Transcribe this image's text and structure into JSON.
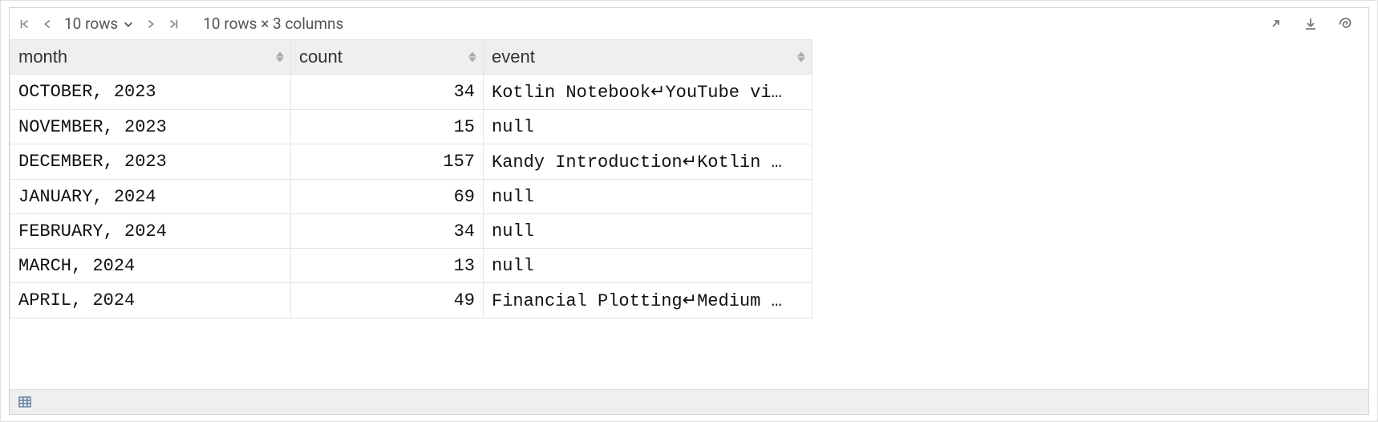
{
  "toolbar": {
    "rows_label": "10 rows",
    "summary": "10 rows × 3 columns"
  },
  "columns": {
    "month": "month",
    "count": "count",
    "event": "event"
  },
  "rows": [
    {
      "month": "OCTOBER, 2023",
      "count": "34",
      "event_pre": "Kotlin Notebook",
      "event_post": "YouTube vi…"
    },
    {
      "month": "NOVEMBER, 2023",
      "count": "15",
      "event_pre": "null",
      "event_post": ""
    },
    {
      "month": "DECEMBER, 2023",
      "count": "157",
      "event_pre": "Kandy Introduction",
      "event_post": "Kotlin …"
    },
    {
      "month": "JANUARY, 2024",
      "count": "69",
      "event_pre": "null",
      "event_post": ""
    },
    {
      "month": "FEBRUARY, 2024",
      "count": "34",
      "event_pre": "null",
      "event_post": ""
    },
    {
      "month": "MARCH, 2024",
      "count": "13",
      "event_pre": "null",
      "event_post": ""
    },
    {
      "month": "APRIL, 2024",
      "count": "49",
      "event_pre": "Financial Plotting",
      "event_post": "Medium …"
    }
  ]
}
